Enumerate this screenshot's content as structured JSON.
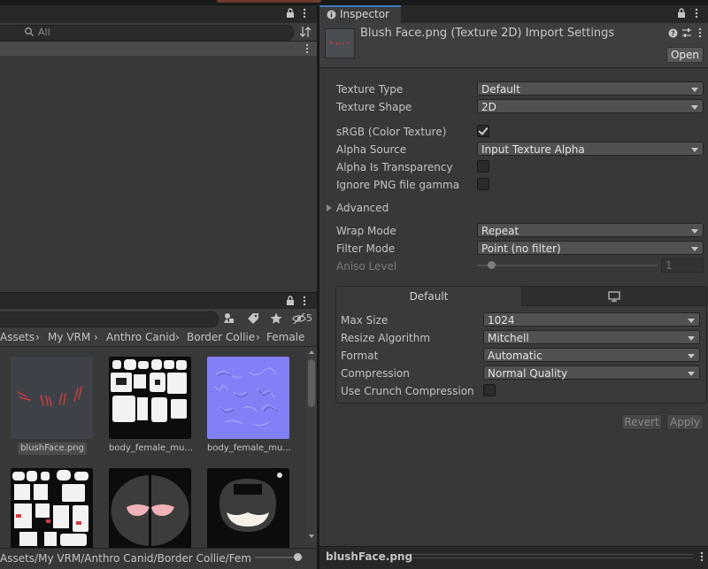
{
  "top_left": {
    "search_placeholder": "All",
    "sort_icon": "sort-icon"
  },
  "project": {
    "search_placeholder": "",
    "hidden_count": "5",
    "breadcrumb": [
      "Assets",
      "My VRM",
      "Anthro Canid",
      "Border Collie",
      "Female"
    ],
    "assets": [
      {
        "name": "blushFace.png",
        "selected": true
      },
      {
        "name": "body_female_mu...",
        "selected": false
      },
      {
        "name": "body_female_mu...",
        "selected": false
      },
      {
        "name": "",
        "selected": false
      },
      {
        "name": "",
        "selected": false
      },
      {
        "name": "",
        "selected": false
      }
    ],
    "path": "Assets/My VRM/Anthro Canid/Border Collie/Fem"
  },
  "inspector": {
    "tab_label": "Inspector",
    "title": "Blush Face.png (Texture 2D) Import Settings",
    "open_label": "Open",
    "fields": {
      "texture_type": {
        "label": "Texture Type",
        "value": "Default"
      },
      "texture_shape": {
        "label": "Texture Shape",
        "value": "2D"
      },
      "srgb": {
        "label": "sRGB (Color Texture)",
        "checked": true
      },
      "alpha_source": {
        "label": "Alpha Source",
        "value": "Input Texture Alpha"
      },
      "alpha_transparency": {
        "label": "Alpha Is Transparency",
        "checked": false
      },
      "ignore_png_gamma": {
        "label": "Ignore PNG file gamma",
        "checked": false
      },
      "advanced": {
        "label": "Advanced"
      },
      "wrap_mode": {
        "label": "Wrap Mode",
        "value": "Repeat"
      },
      "filter_mode": {
        "label": "Filter Mode",
        "value": "Point (no filter)"
      },
      "aniso_level": {
        "label": "Aniso Level",
        "value": "1"
      }
    },
    "platform": {
      "tab_default": "Default",
      "tab_standalone_icon": "monitor-icon",
      "max_size": {
        "label": "Max Size",
        "value": "1024"
      },
      "resize_algorithm": {
        "label": "Resize Algorithm",
        "value": "Mitchell"
      },
      "format": {
        "label": "Format",
        "value": "Automatic"
      },
      "compression": {
        "label": "Compression",
        "value": "Normal Quality"
      },
      "crunch": {
        "label": "Use Crunch Compression",
        "checked": false
      }
    },
    "revert_label": "Revert",
    "apply_label": "Apply",
    "footer_label": "blushFace.png"
  },
  "colors": {
    "background": "#191919",
    "panel": "#383838",
    "control": "#515151",
    "selected_blue": "#2c5d87",
    "normal_map": "#8080ff"
  }
}
